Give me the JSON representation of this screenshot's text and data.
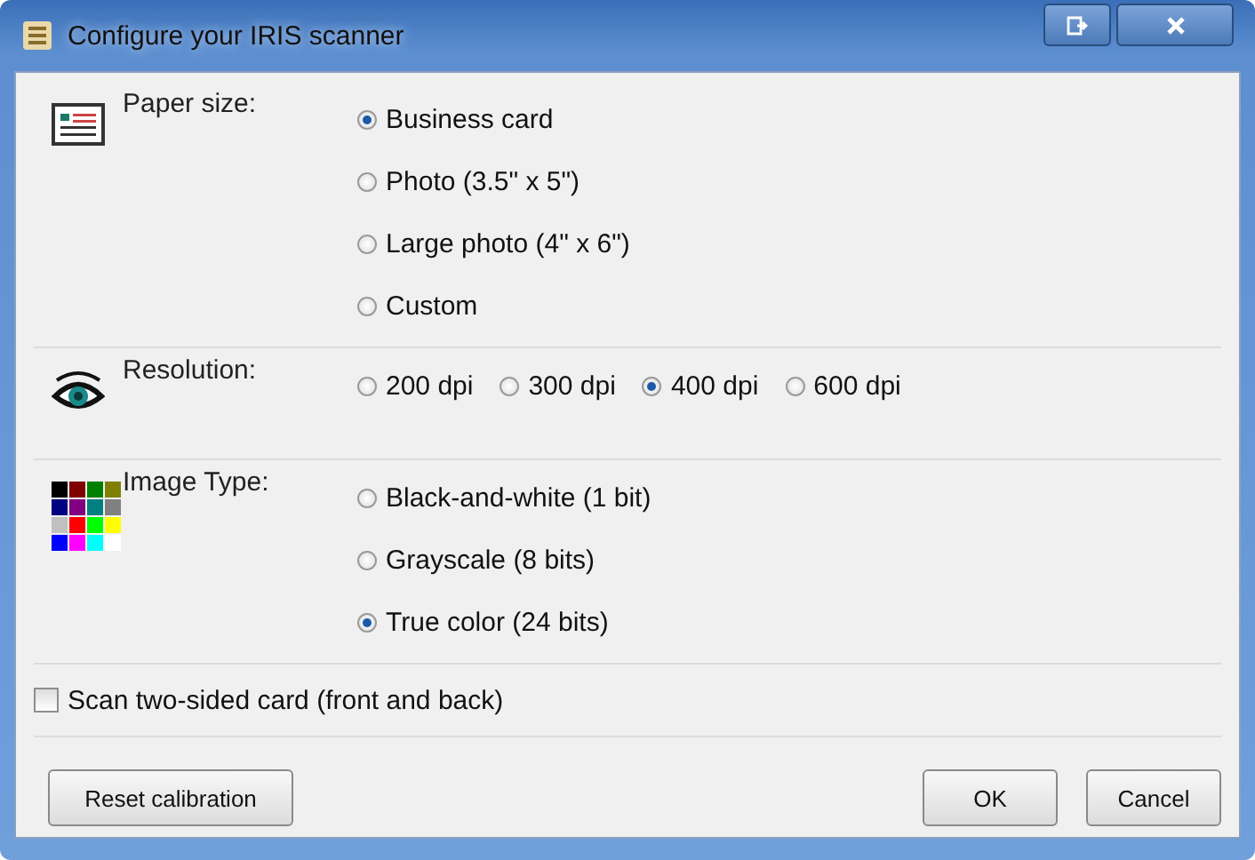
{
  "window": {
    "title": "Configure your IRIS scanner"
  },
  "sections": [
    {
      "label": "Paper size:",
      "kind": "stack",
      "options": [
        {
          "label": "Business card",
          "selected": true
        },
        {
          "label": "Photo (3.5\" x 5\")",
          "selected": false
        },
        {
          "label": "Large photo (4\" x 6\")",
          "selected": false
        },
        {
          "label": "Custom",
          "selected": false
        }
      ]
    },
    {
      "label": "Resolution:",
      "kind": "inline",
      "options": [
        {
          "label": "200 dpi",
          "selected": false
        },
        {
          "label": "300 dpi",
          "selected": false
        },
        {
          "label": "400 dpi",
          "selected": true
        },
        {
          "label": "600 dpi",
          "selected": false
        }
      ]
    },
    {
      "label": "Image Type:",
      "kind": "stack",
      "options": [
        {
          "label": "Black-and-white (1 bit)",
          "selected": false
        },
        {
          "label": "Grayscale (8 bits)",
          "selected": false
        },
        {
          "label": "True color (24 bits)",
          "selected": true
        }
      ]
    }
  ],
  "two_sided": {
    "label": "Scan two-sided card (front and back)",
    "checked": false
  },
  "buttons": {
    "left": [
      "Reset calibration"
    ],
    "right": [
      "OK",
      "Cancel"
    ]
  }
}
